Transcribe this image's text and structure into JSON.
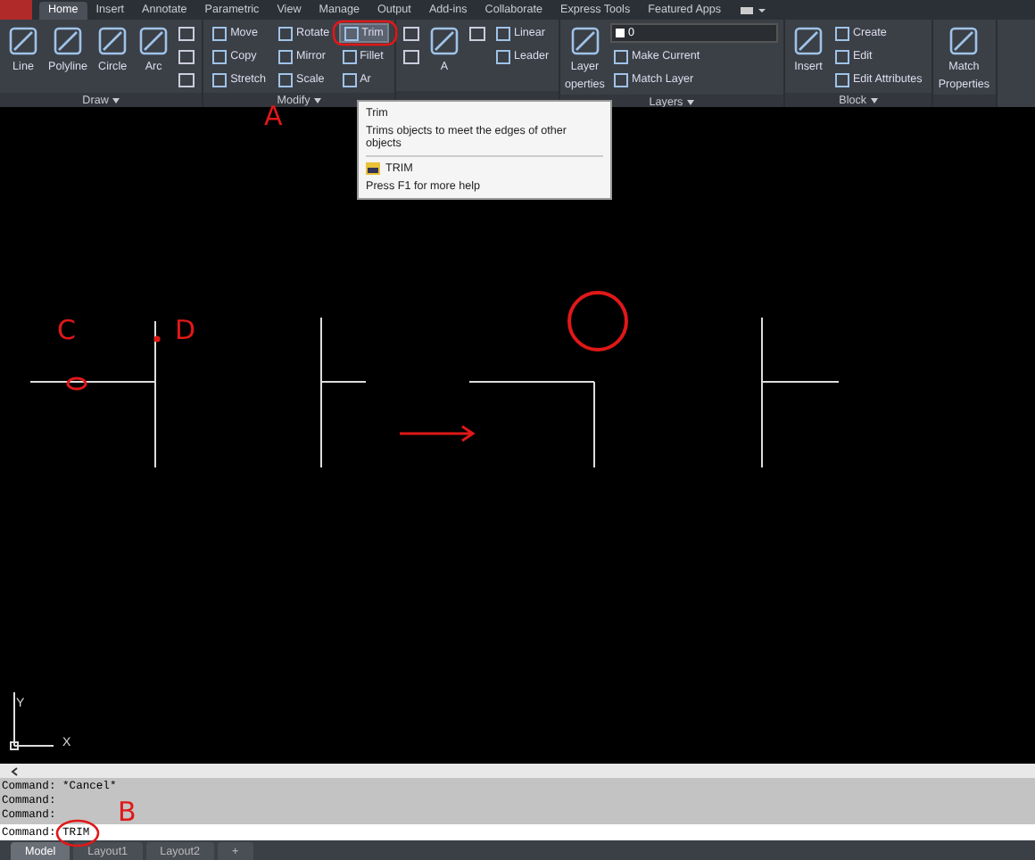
{
  "app_tabs": [
    {
      "label": "Home",
      "selected": true
    },
    {
      "label": "Insert",
      "selected": false
    },
    {
      "label": "Annotate",
      "selected": false
    },
    {
      "label": "Parametric",
      "selected": false
    },
    {
      "label": "View",
      "selected": false
    },
    {
      "label": "Manage",
      "selected": false
    },
    {
      "label": "Output",
      "selected": false
    },
    {
      "label": "Add-ins",
      "selected": false
    },
    {
      "label": "Collaborate",
      "selected": false
    },
    {
      "label": "Express Tools",
      "selected": false
    },
    {
      "label": "Featured Apps",
      "selected": false
    }
  ],
  "ribbon": {
    "panels": [
      {
        "title": "Draw",
        "columns": [
          [
            {
              "kind": "large",
              "label": "Line"
            }
          ],
          [
            {
              "kind": "large",
              "label": "Polyline"
            }
          ],
          [
            {
              "kind": "large",
              "label": "Circle"
            }
          ],
          [
            {
              "kind": "large",
              "label": "Arc"
            }
          ],
          [
            {
              "kind": "icon"
            },
            {
              "kind": "icon"
            },
            {
              "kind": "icon"
            }
          ]
        ]
      },
      {
        "title": "Modify",
        "columns": [
          [
            {
              "kind": "small",
              "label": "Move"
            },
            {
              "kind": "small",
              "label": "Copy"
            },
            {
              "kind": "small",
              "label": "Stretch"
            }
          ],
          [
            {
              "kind": "small",
              "label": "Rotate"
            },
            {
              "kind": "small",
              "label": "Mirror"
            },
            {
              "kind": "small",
              "label": "Scale"
            }
          ],
          [
            {
              "kind": "small",
              "label": "Trim",
              "selected": true
            },
            {
              "kind": "small",
              "label": "Fillet",
              "selected": false
            },
            {
              "kind": "small",
              "label": "Ar",
              "selected": false
            }
          ]
        ]
      },
      {
        "columns": [
          [
            {
              "kind": "icon"
            },
            {
              "kind": "icon"
            }
          ],
          [
            {
              "kind": "large",
              "label": "A"
            }
          ],
          [
            {
              "kind": "icon"
            }
          ],
          [
            {
              "kind": "small",
              "label": "Linear"
            },
            {
              "kind": "small",
              "label": "Leader"
            }
          ]
        ]
      },
      {
        "title": "Layers",
        "columns": [
          [
            {
              "kind": "large",
              "label": "Layer"
            },
            {
              "kind": "text",
              "label": "operties"
            }
          ],
          [
            {
              "kind": "dropdown",
              "label": "0"
            },
            {
              "kind": "small",
              "label": "Make Current"
            },
            {
              "kind": "small",
              "label": "Match Layer"
            }
          ]
        ]
      },
      {
        "title": "Block",
        "columns": [
          [
            {
              "kind": "large",
              "label": "Insert"
            }
          ],
          [
            {
              "kind": "small",
              "label": "Create"
            },
            {
              "kind": "small",
              "label": "Edit"
            },
            {
              "kind": "small",
              "label": "Edit Attributes"
            }
          ]
        ]
      },
      {
        "columns": [
          [
            {
              "kind": "large",
              "label": "Match"
            },
            {
              "kind": "text",
              "label": "Properties"
            }
          ]
        ]
      }
    ]
  },
  "tooltip": {
    "title": "Trim",
    "description": "Trims objects to meet the edges of other objects",
    "command": "TRIM",
    "help": "Press F1 for more help"
  },
  "ucs": {
    "y_label": "Y",
    "x_label": "X"
  },
  "annotations": [
    {
      "label": "A"
    },
    {
      "label": "B"
    },
    {
      "label": "C"
    },
    {
      "label": "D"
    }
  ],
  "command_history": [
    "Command: *Cancel*",
    "Command:",
    "Command:"
  ],
  "command_input": {
    "value": "Command: TRIM"
  },
  "layout_tabs": [
    {
      "label": "Model",
      "selected": true
    },
    {
      "label": "Layout1",
      "selected": false
    },
    {
      "label": "Layout2",
      "selected": false
    },
    {
      "label": "+",
      "selected": false
    }
  ]
}
